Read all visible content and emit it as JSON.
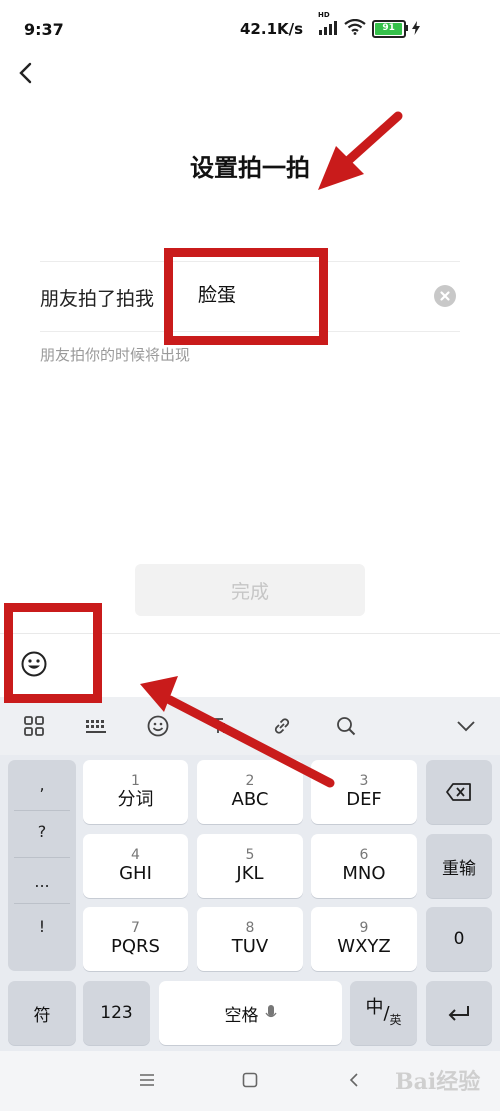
{
  "status_bar": {
    "time": "9:37",
    "speed": "42.1K/s",
    "network_badge": "HD",
    "battery_level": "91",
    "icons": [
      "signal-icon",
      "wifi-icon",
      "battery-icon",
      "charging-icon"
    ]
  },
  "header": {
    "back_icon": "chevron-left-icon",
    "title": "设置拍一拍"
  },
  "form": {
    "label": "朋友拍了拍我",
    "value": "脸蛋",
    "clear_icon": "clear-icon",
    "hint": "朋友拍你的时候将出现"
  },
  "done_button": {
    "label": "完成"
  },
  "emoji_button": {
    "icon": "smiley-icon"
  },
  "keyboard": {
    "toolbar_icons": [
      "grid-icon",
      "keyboard-icon",
      "emoji-icon",
      "text-cursor-icon",
      "link-icon",
      "search-icon",
      "collapse-icon"
    ],
    "punctuation": [
      ",",
      "?",
      "...",
      "!"
    ],
    "rows": [
      [
        {
          "num": "1",
          "letters": "分词"
        },
        {
          "num": "2",
          "letters": "ABC"
        },
        {
          "num": "3",
          "letters": "DEF"
        }
      ],
      [
        {
          "num": "4",
          "letters": "GHI"
        },
        {
          "num": "5",
          "letters": "JKL"
        },
        {
          "num": "6",
          "letters": "MNO"
        }
      ],
      [
        {
          "num": "7",
          "letters": "PQRS"
        },
        {
          "num": "8",
          "letters": "TUV"
        },
        {
          "num": "9",
          "letters": "WXYZ"
        }
      ]
    ],
    "backspace_icon": "backspace-icon",
    "reenter_label": "重输",
    "zero_label": "0",
    "symbols_label": "符",
    "numbers_label": "123",
    "space_label": "空格",
    "mic_icon": "mic-icon",
    "lang_main": "中",
    "lang_sub": "英",
    "enter_icon": "enter-icon"
  },
  "nav_bar": {
    "icons": [
      "menu-icon",
      "home-icon",
      "back-icon"
    ]
  },
  "watermark": "Bai经验",
  "colors": {
    "annotation": "#c91b1b",
    "battery": "#35c04a",
    "keyboard_bg": "#e8ebf0"
  }
}
